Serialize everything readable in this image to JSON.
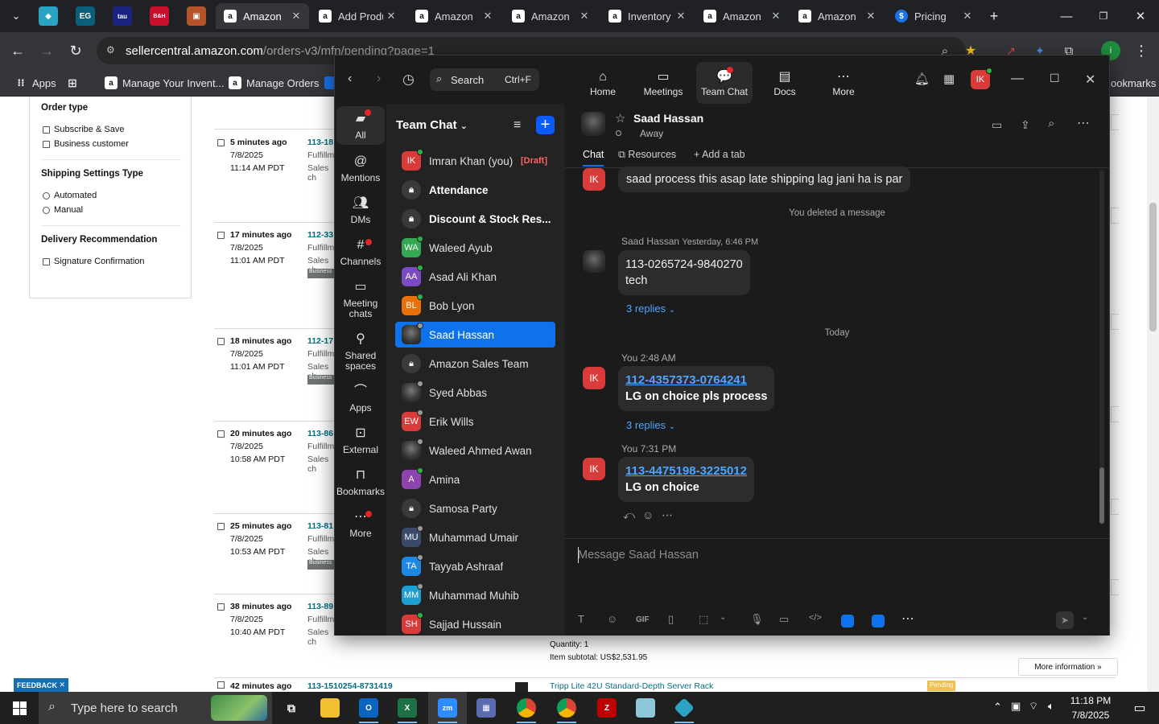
{
  "browser": {
    "tabs": [
      {
        "title": "Amazon",
        "icon": "amazon-icon",
        "active": true
      },
      {
        "title": "Add Product",
        "icon": "amazon-icon"
      },
      {
        "title": "Amazon",
        "icon": "amazon-icon"
      },
      {
        "title": "Amazon",
        "icon": "amazon-icon"
      },
      {
        "title": "Inventory",
        "icon": "amazon-icon"
      },
      {
        "title": "Amazon",
        "icon": "amazon-icon"
      },
      {
        "title": "Amazon",
        "icon": "amazon-icon"
      },
      {
        "title": "Pricing",
        "icon": "dollar-icon"
      }
    ],
    "pinned": [
      "EG",
      "tau",
      "B&H"
    ],
    "url_domain": "sellercentral.amazon.com",
    "url_path": "/orders-v3/mfn/pending?page=1",
    "bookmarks": [
      "Apps",
      "Manage Your Invent...",
      "Manage Orders"
    ],
    "bookmarks_right": "ookmarks"
  },
  "amazon": {
    "filters": {
      "order_type_title": "Order type",
      "order_type": [
        "Subscribe & Save",
        "Business customer"
      ],
      "shipping_title": "Shipping Settings Type",
      "shipping": [
        "Automated",
        "Manual"
      ],
      "delivery_title": "Delivery Recommendation",
      "delivery": [
        "Signature Confirmation"
      ]
    },
    "orders": [
      {
        "ago": "5 minutes ago",
        "date": "7/8/2025",
        "time": "11:14 AM PDT",
        "id": "113-18",
        "f1": "Fulfillm",
        "f2": "Sales ch",
        "biz": ""
      },
      {
        "ago": "17 minutes ago",
        "date": "7/8/2025",
        "time": "11:01 AM PDT",
        "id": "112-33",
        "f1": "Fulfillm",
        "f2": "Sales ch",
        "biz": "Business"
      },
      {
        "ago": "18 minutes ago",
        "date": "7/8/2025",
        "time": "11:01 AM PDT",
        "id": "112-17",
        "f1": "Fulfillm",
        "f2": "Sales ch",
        "biz": "Business"
      },
      {
        "ago": "20 minutes ago",
        "date": "7/8/2025",
        "time": "10:58 AM PDT",
        "id": "113-86",
        "f1": "Fulfillm",
        "f2": "Sales ch",
        "biz": ""
      },
      {
        "ago": "25 minutes ago",
        "date": "7/8/2025",
        "time": "10:53 AM PDT",
        "id": "113-81",
        "f1": "Fulfillm",
        "f2": "Sales ch",
        "biz": "Business"
      },
      {
        "ago": "38 minutes ago",
        "date": "7/8/2025",
        "time": "10:40 AM PDT",
        "id": "113-89",
        "f1": "Fulfillm",
        "f2": "Sales ch",
        "biz": ""
      }
    ],
    "last_order": {
      "ago": "42 minutes ago",
      "id": "113-1510254-8731419",
      "product": "Tripp Lite 42U Standard-Depth Server Rack",
      "status": "Pending"
    },
    "quantity": "Quantity: 1",
    "subtotal": "Item subtotal: US$2,531.95",
    "more_info": "More information",
    "feedback": "FEEDBACK"
  },
  "zoom": {
    "search_label": "Search",
    "search_shortcut": "Ctrl+F",
    "nav": [
      "Home",
      "Meetings",
      "Team Chat",
      "Docs",
      "More"
    ],
    "rail": [
      "All",
      "Mentions",
      "DMs",
      "Channels",
      "Meeting chats",
      "Shared spaces",
      "Apps",
      "External",
      "Bookmarks",
      "More"
    ],
    "list_title": "Team Chat",
    "contacts": [
      {
        "name": "Imran Khan (you)",
        "initials": "IK",
        "color": "#d93b3b",
        "status": "#2fb344",
        "draft": "[Draft]"
      },
      {
        "name": "Attendance",
        "initials": "",
        "lock": true,
        "bold": true
      },
      {
        "name": "Discount & Stock Res...",
        "initials": "",
        "lock": true,
        "bold": true
      },
      {
        "name": "Waleed Ayub",
        "initials": "WA",
        "color": "#34a853",
        "status": "#2fb344"
      },
      {
        "name": "Asad Ali Khan",
        "initials": "AA",
        "color": "#7a4bc2",
        "status": "#2fb344"
      },
      {
        "name": "Bob Lyon",
        "initials": "BL",
        "color": "#e8710a",
        "status": "#2fb344"
      },
      {
        "name": "Saad Hassan",
        "initials": "",
        "photo": true,
        "selected": true,
        "status": "#9a9a9a"
      },
      {
        "name": "Amazon Sales Team",
        "initials": "",
        "lock": true
      },
      {
        "name": "Syed Abbas",
        "initials": "",
        "photo": true,
        "status": "#9a9a9a"
      },
      {
        "name": "Erik Wills",
        "initials": "EW",
        "color": "#d93b3b",
        "status": "#9a9a9a"
      },
      {
        "name": "Waleed Ahmed Awan",
        "initials": "",
        "photo": true,
        "status": "#9a9a9a"
      },
      {
        "name": "Amina",
        "initials": "A",
        "color": "#8e44ad",
        "status": "#2fb344"
      },
      {
        "name": "Samosa Party",
        "initials": "",
        "lock": true
      },
      {
        "name": "Muhammad Umair",
        "initials": "MU",
        "color": "#3a4a6a",
        "status": "#9a9a9a"
      },
      {
        "name": "Tayyab Ashraaf",
        "initials": "TA",
        "color": "#1e88e5",
        "status": "#9a9a9a"
      },
      {
        "name": "Muhammad Muhib",
        "initials": "MM",
        "color": "#1f9fd1",
        "status": "#9a9a9a"
      },
      {
        "name": "Sajjad Hussain",
        "initials": "SH",
        "color": "#d93b3b",
        "status": "#2fb344"
      }
    ],
    "chat": {
      "name": "Saad Hassan",
      "status": "Away",
      "tabs": [
        "Chat",
        "Resources",
        "Add a tab"
      ],
      "messages": {
        "m0": "saad process this asap late shipping lag jani ha is par",
        "deleted": "You deleted a message",
        "m1_meta_name": "Saad Hassan",
        "m1_meta_time": "Yesterday, 6:46 PM",
        "m1_line1": "113-0265724-9840270",
        "m1_line2": "tech",
        "m1_replies": "3 replies",
        "today": "Today",
        "m2_meta": "You 2:48 AM",
        "m2_link": "112-4357373-0764241",
        "m2_text": "LG on choice pls process",
        "m2_replies": "3 replies",
        "m3_meta": "You 7:31 PM",
        "m3_link": "113-4475198-3225012",
        "m3_text": "LG on choice"
      },
      "compose_placeholder": "Message Saad Hassan"
    },
    "user_initials": "IK"
  },
  "taskbar": {
    "search_placeholder": "Type here to search",
    "time": "11:18 PM",
    "date": "7/8/2025"
  }
}
